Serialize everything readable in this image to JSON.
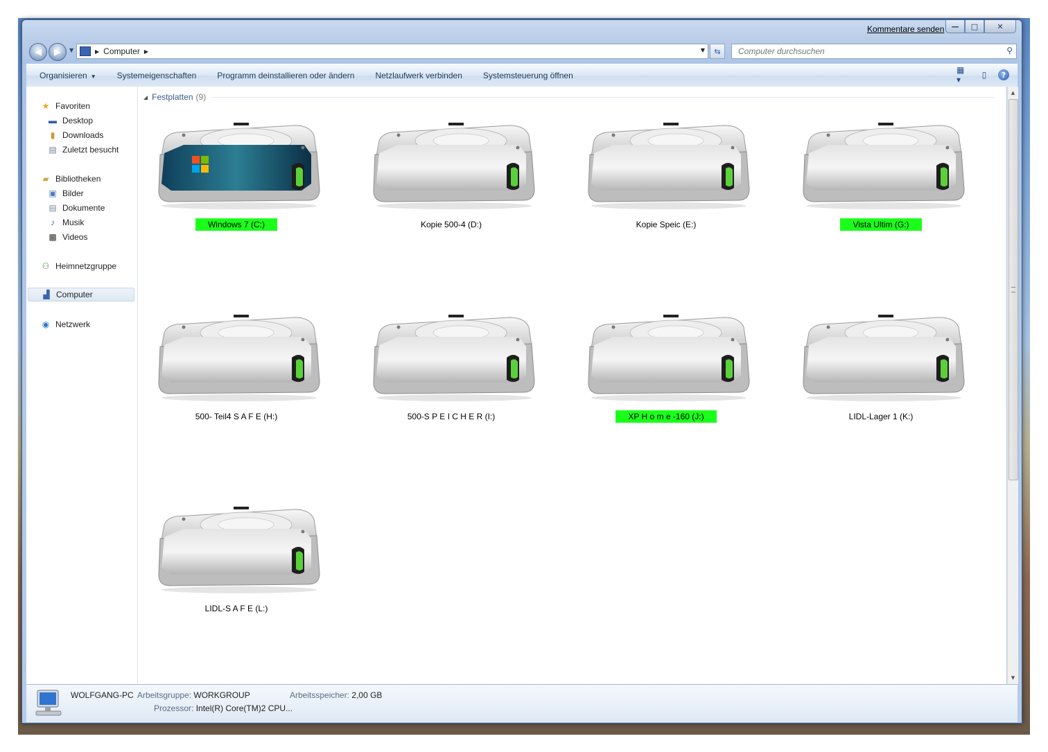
{
  "window": {
    "feedback_link": "Kommentare senden",
    "caption_buttons": {
      "minimize": "—",
      "maximize": "□",
      "close": "✕"
    }
  },
  "address": {
    "crumbs": [
      "Computer"
    ],
    "search_placeholder": "Computer durchsuchen"
  },
  "toolbar": {
    "items": [
      "Organisieren",
      "Systemeigenschaften",
      "Programm deinstallieren oder ändern",
      "Netzlaufwerk verbinden",
      "Systemsteuerung öffnen"
    ]
  },
  "sidebar": {
    "favorites": {
      "label": "Favoriten",
      "items": [
        "Desktop",
        "Downloads",
        "Zuletzt besucht"
      ]
    },
    "libraries": {
      "label": "Bibliotheken",
      "items": [
        "Bilder",
        "Dokumente",
        "Musik",
        "Videos"
      ]
    },
    "homegroup": "Heimnetzgruppe",
    "computer": "Computer",
    "network": "Netzwerk"
  },
  "group": {
    "title": "Festplatten",
    "count": "(9)"
  },
  "drives": [
    {
      "label": "Windows 7 (C:)",
      "highlight": true,
      "system": true
    },
    {
      "label": "Kopie 500-4 (D:)",
      "highlight": false,
      "system": false
    },
    {
      "label": "Kopie Speic (E:)",
      "highlight": false,
      "system": false
    },
    {
      "label": "Vista Ultim (G:)",
      "highlight": true,
      "system": false
    },
    {
      "label": "500- Teil4  S A F E (H:)",
      "highlight": false,
      "system": false
    },
    {
      "label": "500-S P E I C H E R (I:)",
      "highlight": false,
      "system": false
    },
    {
      "label": "XP H o m e -160 (J:)",
      "highlight": true,
      "system": false
    },
    {
      "label": "LIDL-Lager 1 (K:)",
      "highlight": false,
      "system": false
    },
    {
      "label": "LIDL-S A F E (L:)",
      "highlight": false,
      "system": false
    }
  ],
  "details": {
    "pc_name": "WOLFGANG-PC",
    "workgroup_key": "Arbeitsgruppe:",
    "workgroup_val": "WORKGROUP",
    "memory_key": "Arbeitsspeicher:",
    "memory_val": "2,00 GB",
    "cpu_key": "Prozessor:",
    "cpu_val": "Intel(R) Core(TM)2 CPU..."
  },
  "colors": {
    "highlight": "#1aff1a",
    "link": "#1e395b"
  }
}
